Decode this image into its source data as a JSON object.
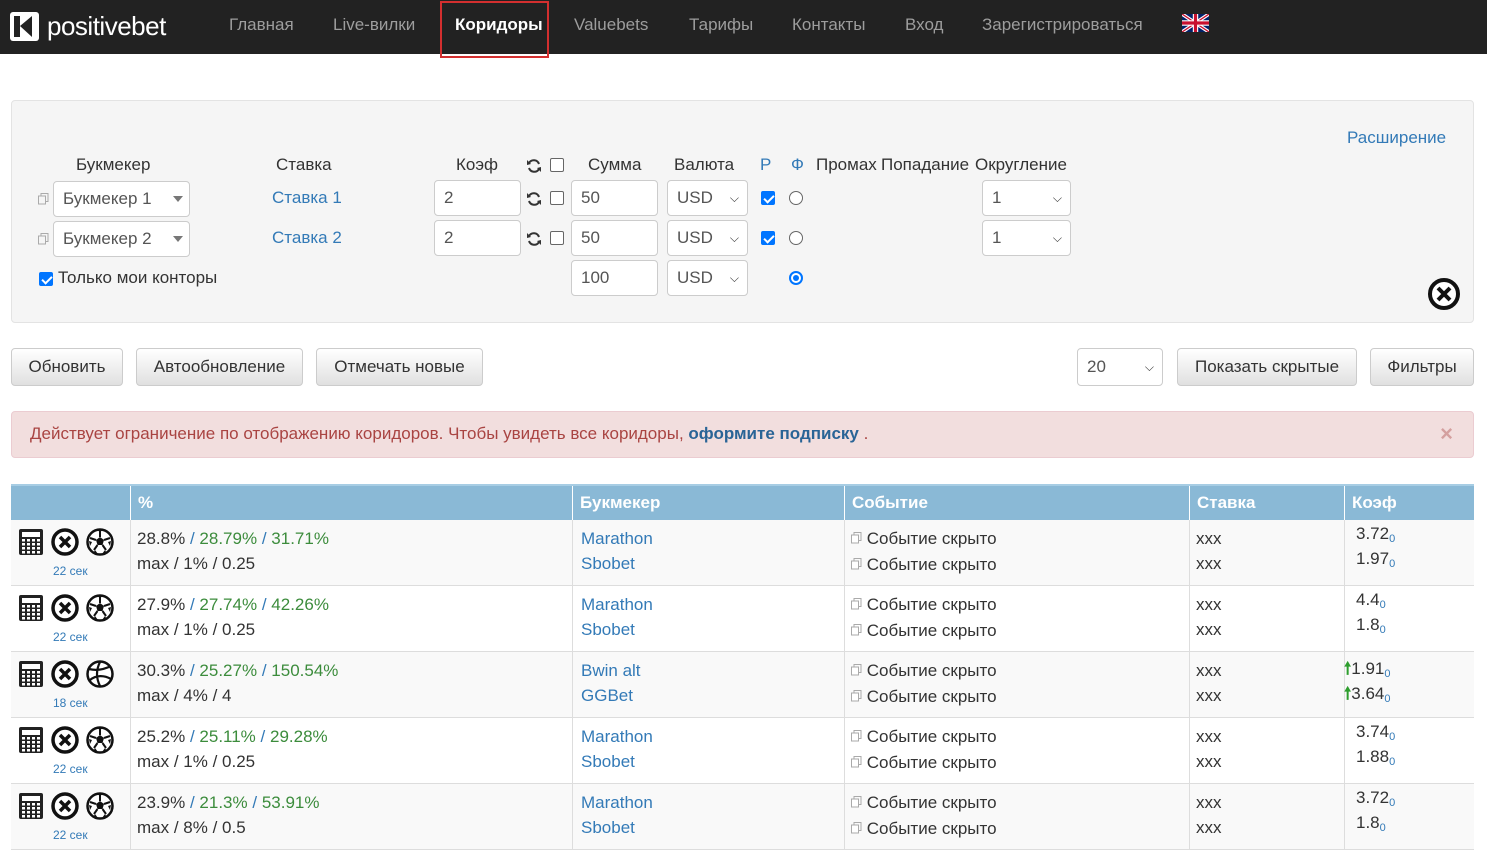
{
  "nav": {
    "brand": "positivebet",
    "items": [
      "Главная",
      "Live-вилки",
      "Коридоры",
      "Valuebets",
      "Тарифы",
      "Контакты",
      "Вход",
      "Зарегистрироваться"
    ],
    "active": "Коридоры"
  },
  "panel": {
    "extension_link": "Расширение",
    "headers": {
      "bookmaker": "Букмекер",
      "stake": "Ставка",
      "coef": "Коэф",
      "sum": "Сумма",
      "currency": "Валюта",
      "p": "Р",
      "f": "Ф",
      "miss": "Промах",
      "hit": "Попадание",
      "rounding": "Округление"
    },
    "rows": [
      {
        "bookmaker": "Букмекер 1",
        "stake": "Ставка 1",
        "coef": "2",
        "sum": "50",
        "currency": "USD",
        "rounding": "1"
      },
      {
        "bookmaker": "Букмекер 2",
        "stake": "Ставка 2",
        "coef": "2",
        "sum": "50",
        "currency": "USD",
        "rounding": "1"
      }
    ],
    "total_sum": "100",
    "total_currency": "USD",
    "only_my_label": "Только мои конторы"
  },
  "toolbar": {
    "refresh": "Обновить",
    "autorefresh": "Автообновление",
    "mark_new": "Отмечать новые",
    "page_size": "20",
    "show_hidden": "Показать скрытые",
    "filters": "Фильтры"
  },
  "alert": {
    "text": "Действует ограничение по отображению коридоров. Чтобы увидеть все коридоры,",
    "link": "оформите подписку",
    "tail": ".",
    "close": "×"
  },
  "table": {
    "headers": [
      "%",
      "Букмекер",
      "Событие",
      "Ставка",
      "Коэф"
    ],
    "rows": [
      {
        "age": "22 сек",
        "sport": "football",
        "pct": "28.8%",
        "pct2": "28.79%",
        "pct3": "31.71%",
        "line2": "max / 1% / 0.25",
        "bk1": "Marathon",
        "bk2": "Sbobet",
        "ev1": "Событие скрыто",
        "ev2": "Событие скрыто",
        "st1": "xxx",
        "st2": "xxx",
        "k1": "3.72",
        "k2": "1.97",
        "sub": "0"
      },
      {
        "age": "22 сек",
        "sport": "football",
        "pct": "27.9%",
        "pct2": "27.74%",
        "pct3": "42.26%",
        "line2": "max / 1% / 0.25",
        "bk1": "Marathon",
        "bk2": "Sbobet",
        "ev1": "Событие скрыто",
        "ev2": "Событие скрыто",
        "st1": "xxx",
        "st2": "xxx",
        "k1": "4.4",
        "k2": "1.8",
        "sub": "0"
      },
      {
        "age": "18 сек",
        "sport": "volleyball",
        "pct": "30.3%",
        "pct2": "25.27%",
        "pct3": "150.54%",
        "line2": "max / 4% / 4",
        "bk1": "Bwin alt",
        "bk2": "GGBet",
        "ev1": "Событие скрыто",
        "ev2": "Событие скрыто",
        "st1": "xxx",
        "st2": "xxx",
        "k1": "1.91",
        "k2": "3.64",
        "sub": "0"
      },
      {
        "age": "22 сек",
        "sport": "football",
        "pct": "25.2%",
        "pct2": "25.11%",
        "pct3": "29.28%",
        "line2": "max / 1% / 0.25",
        "bk1": "Marathon",
        "bk2": "Sbobet",
        "ev1": "Событие скрыто",
        "ev2": "Событие скрыто",
        "st1": "xxx",
        "st2": "xxx",
        "k1": "3.74",
        "k2": "1.88",
        "sub": "0"
      },
      {
        "age": "22 сек",
        "sport": "football",
        "pct": "23.9%",
        "pct2": "21.3%",
        "pct3": "53.91%",
        "line2": "max / 8% / 0.5",
        "bk1": "Marathon",
        "bk2": "Sbobet",
        "ev1": "Событие скрыто",
        "ev2": "Событие скрыто",
        "st1": "xxx",
        "st2": "xxx",
        "k1": "3.72",
        "k2": "1.8",
        "sub": "0"
      }
    ]
  },
  "colors": {
    "navbar": "#222222",
    "table_header": "#8ab9d6",
    "link": "#337ab7",
    "alert_bg": "#f2dede",
    "green": "#3c8c3c"
  }
}
